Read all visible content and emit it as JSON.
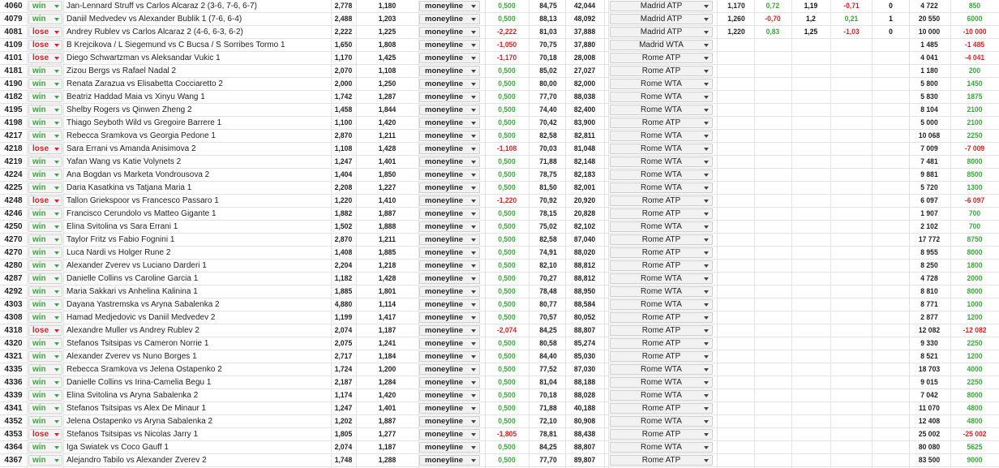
{
  "colors": {
    "win": "#38a838",
    "lose": "#e02020",
    "grid": "#e3e3e3"
  },
  "rows": [
    {
      "id": "4060",
      "result": "win",
      "match": "Jan-Lennard Struff vs Carlos Alcaraz 2 (3-6, 7-6, 6-7)",
      "odds": "2,778",
      "opp": "1,180",
      "market": "moneyline",
      "pl": "0,500",
      "pl_color": "g",
      "p1": "84,75",
      "p2": "42,044",
      "event": "Madrid ATP",
      "e1": "1,170",
      "e2": "0,72",
      "e3": "1,19",
      "e4": "-0,71",
      "e5": "0",
      "bank": "4 722",
      "profit": "850",
      "profit_color": "g"
    },
    {
      "id": "4079",
      "result": "win",
      "match": "Daniil Medvedev vs Alexander Bublik 1 (7-6, 6-4)",
      "odds": "2,488",
      "opp": "1,203",
      "market": "moneyline",
      "pl": "0,500",
      "pl_color": "g",
      "p1": "88,13",
      "p2": "48,092",
      "event": "Madrid ATP",
      "e1": "1,260",
      "e2": "-0,70",
      "e3": "1,2",
      "e4": "0,21",
      "e5": "1",
      "bank": "20 550",
      "profit": "6000",
      "profit_color": "g"
    },
    {
      "id": "4081",
      "result": "lose",
      "match": "Andrey Rublev vs Carlos Alcaraz 2 (4-6, 6-3, 6-2)",
      "odds": "2,222",
      "opp": "1,225",
      "market": "moneyline",
      "pl": "-2,222",
      "pl_color": "r",
      "p1": "81,03",
      "p2": "37,888",
      "event": "Madrid ATP",
      "e1": "1,220",
      "e2": "0,83",
      "e3": "1,25",
      "e4": "-1,03",
      "e5": "0",
      "bank": "10 000",
      "profit": "-10 000",
      "profit_color": "r"
    },
    {
      "id": "4109",
      "result": "lose",
      "match": "B Krejcikova / L Siegemund vs C Bucsa / S Sorribes Tormo 1",
      "odds": "1,650",
      "opp": "1,808",
      "market": "moneyline",
      "pl": "-1,050",
      "pl_color": "r",
      "p1": "70,75",
      "p2": "37,880",
      "event": "Madrid WTA",
      "e1": "",
      "e2": "",
      "e3": "",
      "e4": "",
      "e5": "",
      "bank": "1 485",
      "profit": "-1 485",
      "profit_color": "r"
    },
    {
      "id": "4101",
      "result": "lose",
      "match": "Diego Schwartzman vs Aleksandar Vukic 1",
      "odds": "1,170",
      "opp": "1,425",
      "market": "moneyline",
      "pl": "-1,170",
      "pl_color": "r",
      "p1": "70,18",
      "p2": "28,008",
      "event": "Rome ATP",
      "e1": "",
      "e2": "",
      "e3": "",
      "e4": "",
      "e5": "",
      "bank": "4 041",
      "profit": "-4 041",
      "profit_color": "r"
    },
    {
      "id": "4181",
      "result": "win",
      "match": "Zizou Bergs vs Rafael Nadal 2",
      "odds": "2,070",
      "opp": "1,108",
      "market": "moneyline",
      "pl": "0,500",
      "pl_color": "g",
      "p1": "85,02",
      "p2": "27,027",
      "event": "Rome ATP",
      "e1": "",
      "e2": "",
      "e3": "",
      "e4": "",
      "e5": "",
      "bank": "1 180",
      "profit": "200",
      "profit_color": "g"
    },
    {
      "id": "4190",
      "result": "win",
      "match": "Renata Zarazua vs Elisabetta Cocciaretto 2",
      "odds": "2,000",
      "opp": "1,250",
      "market": "moneyline",
      "pl": "0,500",
      "pl_color": "g",
      "p1": "80,00",
      "p2": "82,000",
      "event": "Rome WTA",
      "e1": "",
      "e2": "",
      "e3": "",
      "e4": "",
      "e5": "",
      "bank": "5 800",
      "profit": "1450",
      "profit_color": "g"
    },
    {
      "id": "4182",
      "result": "win",
      "match": "Beatriz Haddad Maia vs Xinyu Wang 1",
      "odds": "1,742",
      "opp": "1,287",
      "market": "moneyline",
      "pl": "0,500",
      "pl_color": "g",
      "p1": "77,70",
      "p2": "88,038",
      "event": "Rome WTA",
      "e1": "",
      "e2": "",
      "e3": "",
      "e4": "",
      "e5": "",
      "bank": "5 830",
      "profit": "1875",
      "profit_color": "g"
    },
    {
      "id": "4195",
      "result": "win",
      "match": "Shelby Rogers vs Qinwen Zheng 2",
      "odds": "1,458",
      "opp": "1,844",
      "market": "moneyline",
      "pl": "0,500",
      "pl_color": "g",
      "p1": "74,40",
      "p2": "82,400",
      "event": "Rome WTA",
      "e1": "",
      "e2": "",
      "e3": "",
      "e4": "",
      "e5": "",
      "bank": "8 104",
      "profit": "2100",
      "profit_color": "g"
    },
    {
      "id": "4198",
      "result": "win",
      "match": "Thiago Seyboth Wild vs Gregoire Barrere 1",
      "odds": "1,100",
      "opp": "1,420",
      "market": "moneyline",
      "pl": "0,500",
      "pl_color": "g",
      "p1": "70,42",
      "p2": "83,900",
      "event": "Rome ATP",
      "e1": "",
      "e2": "",
      "e3": "",
      "e4": "",
      "e5": "",
      "bank": "5 000",
      "profit": "2100",
      "profit_color": "g"
    },
    {
      "id": "4217",
      "result": "win",
      "match": "Rebecca Sramkova vs Georgia Pedone 1",
      "odds": "2,870",
      "opp": "1,211",
      "market": "moneyline",
      "pl": "0,500",
      "pl_color": "g",
      "p1": "82,58",
      "p2": "82,811",
      "event": "Rome WTA",
      "e1": "",
      "e2": "",
      "e3": "",
      "e4": "",
      "e5": "",
      "bank": "10 068",
      "profit": "2250",
      "profit_color": "g"
    },
    {
      "id": "4218",
      "result": "lose",
      "match": "Sara Errani vs Amanda Anisimova 2",
      "odds": "1,108",
      "opp": "1,428",
      "market": "moneyline",
      "pl": "-1,108",
      "pl_color": "r",
      "p1": "70,03",
      "p2": "81,048",
      "event": "Rome WTA",
      "e1": "",
      "e2": "",
      "e3": "",
      "e4": "",
      "e5": "",
      "bank": "7 009",
      "profit": "-7 009",
      "profit_color": "r"
    },
    {
      "id": "4219",
      "result": "win",
      "match": "Yafan Wang vs Katie Volynets 2",
      "odds": "1,247",
      "opp": "1,401",
      "market": "moneyline",
      "pl": "0,500",
      "pl_color": "g",
      "p1": "71,88",
      "p2": "82,148",
      "event": "Rome WTA",
      "e1": "",
      "e2": "",
      "e3": "",
      "e4": "",
      "e5": "",
      "bank": "7 481",
      "profit": "8000",
      "profit_color": "g"
    },
    {
      "id": "4224",
      "result": "win",
      "match": "Ana Bogdan vs Marketa Vondrousova 2",
      "odds": "1,404",
      "opp": "1,850",
      "market": "moneyline",
      "pl": "0,500",
      "pl_color": "g",
      "p1": "78,75",
      "p2": "82,183",
      "event": "Rome WTA",
      "e1": "",
      "e2": "",
      "e3": "",
      "e4": "",
      "e5": "",
      "bank": "9 881",
      "profit": "8500",
      "profit_color": "g"
    },
    {
      "id": "4225",
      "result": "win",
      "match": "Daria Kasatkina vs Tatjana Maria 1",
      "odds": "2,208",
      "opp": "1,227",
      "market": "moneyline",
      "pl": "0,500",
      "pl_color": "g",
      "p1": "81,50",
      "p2": "82,001",
      "event": "Rome WTA",
      "e1": "",
      "e2": "",
      "e3": "",
      "e4": "",
      "e5": "",
      "bank": "5 720",
      "profit": "1300",
      "profit_color": "g"
    },
    {
      "id": "4248",
      "result": "lose",
      "match": "Tallon Griekspoor vs Francesco Passaro 1",
      "odds": "1,220",
      "opp": "1,410",
      "market": "moneyline",
      "pl": "-1,220",
      "pl_color": "r",
      "p1": "70,92",
      "p2": "20,920",
      "event": "Rome ATP",
      "e1": "",
      "e2": "",
      "e3": "",
      "e4": "",
      "e5": "",
      "bank": "6 097",
      "profit": "-6 097",
      "profit_color": "r"
    },
    {
      "id": "4246",
      "result": "win",
      "match": "Francisco Cerundolo vs Matteo Gigante 1",
      "odds": "1,882",
      "opp": "1,887",
      "market": "moneyline",
      "pl": "0,500",
      "pl_color": "g",
      "p1": "78,15",
      "p2": "20,828",
      "event": "Rome ATP",
      "e1": "",
      "e2": "",
      "e3": "",
      "e4": "",
      "e5": "",
      "bank": "1 907",
      "profit": "700",
      "profit_color": "g"
    },
    {
      "id": "4250",
      "result": "win",
      "match": "Elina Svitolina vs Sara Errani 1",
      "odds": "1,502",
      "opp": "1,888",
      "market": "moneyline",
      "pl": "0,500",
      "pl_color": "g",
      "p1": "75,02",
      "p2": "82,102",
      "event": "Rome WTA",
      "e1": "",
      "e2": "",
      "e3": "",
      "e4": "",
      "e5": "",
      "bank": "2 102",
      "profit": "700",
      "profit_color": "g"
    },
    {
      "id": "4270",
      "result": "win",
      "match": "Taylor Fritz vs Fabio Fognini 1",
      "odds": "2,870",
      "opp": "1,211",
      "market": "moneyline",
      "pl": "0,500",
      "pl_color": "g",
      "p1": "82,58",
      "p2": "87,040",
      "event": "Rome ATP",
      "e1": "",
      "e2": "",
      "e3": "",
      "e4": "",
      "e5": "",
      "bank": "17 772",
      "profit": "8750",
      "profit_color": "g"
    },
    {
      "id": "4270",
      "result": "win",
      "match": "Luca Nardi vs Holger Rune 2",
      "odds": "1,408",
      "opp": "1,885",
      "market": "moneyline",
      "pl": "0,500",
      "pl_color": "g",
      "p1": "74,91",
      "p2": "88,020",
      "event": "Rome ATP",
      "e1": "",
      "e2": "",
      "e3": "",
      "e4": "",
      "e5": "",
      "bank": "8 955",
      "profit": "8000",
      "profit_color": "g"
    },
    {
      "id": "4280",
      "result": "win",
      "match": "Alexander Zverev vs Luciano Darderi 1",
      "odds": "2,204",
      "opp": "1,218",
      "market": "moneyline",
      "pl": "0,500",
      "pl_color": "g",
      "p1": "82,10",
      "p2": "88,812",
      "event": "Rome ATP",
      "e1": "",
      "e2": "",
      "e3": "",
      "e4": "",
      "e5": "",
      "bank": "8 250",
      "profit": "1800",
      "profit_color": "g"
    },
    {
      "id": "4287",
      "result": "win",
      "match": "Danielle Collins vs Caroline Garcia 1",
      "odds": "1,182",
      "opp": "1,428",
      "market": "moneyline",
      "pl": "0,500",
      "pl_color": "g",
      "p1": "70,27",
      "p2": "88,812",
      "event": "Rome WTA",
      "e1": "",
      "e2": "",
      "e3": "",
      "e4": "",
      "e5": "",
      "bank": "4 728",
      "profit": "2000",
      "profit_color": "g"
    },
    {
      "id": "4292",
      "result": "win",
      "match": "Maria Sakkari vs Anhelina Kalinina 1",
      "odds": "1,885",
      "opp": "1,801",
      "market": "moneyline",
      "pl": "0,500",
      "pl_color": "g",
      "p1": "78,48",
      "p2": "88,950",
      "event": "Rome WTA",
      "e1": "",
      "e2": "",
      "e3": "",
      "e4": "",
      "e5": "",
      "bank": "8 810",
      "profit": "8000",
      "profit_color": "g"
    },
    {
      "id": "4303",
      "result": "win",
      "match": "Dayana Yastremska vs Aryna Sabalenka 2",
      "odds": "4,880",
      "opp": "1,114",
      "market": "moneyline",
      "pl": "0,500",
      "pl_color": "g",
      "p1": "80,77",
      "p2": "88,584",
      "event": "Rome WTA",
      "e1": "",
      "e2": "",
      "e3": "",
      "e4": "",
      "e5": "",
      "bank": "8 771",
      "profit": "1000",
      "profit_color": "g"
    },
    {
      "id": "4308",
      "result": "win",
      "match": "Hamad Medjedovic vs Daniil Medvedev 2",
      "odds": "1,199",
      "opp": "1,417",
      "market": "moneyline",
      "pl": "0,500",
      "pl_color": "g",
      "p1": "70,57",
      "p2": "80,052",
      "event": "Rome ATP",
      "e1": "",
      "e2": "",
      "e3": "",
      "e4": "",
      "e5": "",
      "bank": "2 877",
      "profit": "1200",
      "profit_color": "g"
    },
    {
      "id": "4318",
      "result": "lose",
      "match": "Alexandre Muller vs Andrey Rublev 2",
      "odds": "2,074",
      "opp": "1,187",
      "market": "moneyline",
      "pl": "-2,074",
      "pl_color": "r",
      "p1": "84,25",
      "p2": "88,807",
      "event": "Rome ATP",
      "e1": "",
      "e2": "",
      "e3": "",
      "e4": "",
      "e5": "",
      "bank": "12 082",
      "profit": "-12 082",
      "profit_color": "r"
    },
    {
      "id": "4320",
      "result": "win",
      "match": "Stefanos Tsitsipas vs Cameron Norrie 1",
      "odds": "2,075",
      "opp": "1,241",
      "market": "moneyline",
      "pl": "0,500",
      "pl_color": "g",
      "p1": "80,58",
      "p2": "85,274",
      "event": "Rome ATP",
      "e1": "",
      "e2": "",
      "e3": "",
      "e4": "",
      "e5": "",
      "bank": "9 330",
      "profit": "2250",
      "profit_color": "g"
    },
    {
      "id": "4321",
      "result": "win",
      "match": "Alexander Zverev vs Nuno Borges 1",
      "odds": "2,717",
      "opp": "1,184",
      "market": "moneyline",
      "pl": "0,500",
      "pl_color": "g",
      "p1": "84,40",
      "p2": "85,030",
      "event": "Rome ATP",
      "e1": "",
      "e2": "",
      "e3": "",
      "e4": "",
      "e5": "",
      "bank": "8 521",
      "profit": "1200",
      "profit_color": "g"
    },
    {
      "id": "4335",
      "result": "win",
      "match": "Rebecca Sramkova vs Jelena Ostapenko 2",
      "odds": "1,724",
      "opp": "1,200",
      "market": "moneyline",
      "pl": "0,500",
      "pl_color": "g",
      "p1": "77,52",
      "p2": "87,030",
      "event": "Rome WTA",
      "e1": "",
      "e2": "",
      "e3": "",
      "e4": "",
      "e5": "",
      "bank": "18 703",
      "profit": "4000",
      "profit_color": "g"
    },
    {
      "id": "4336",
      "result": "win",
      "match": "Danielle Collins vs Irina-Camelia Begu 1",
      "odds": "2,187",
      "opp": "1,284",
      "market": "moneyline",
      "pl": "0,500",
      "pl_color": "g",
      "p1": "81,04",
      "p2": "88,188",
      "event": "Rome WTA",
      "e1": "",
      "e2": "",
      "e3": "",
      "e4": "",
      "e5": "",
      "bank": "9 015",
      "profert": "",
      "profit": "2250",
      "profit_color": "g"
    },
    {
      "id": "4339",
      "result": "win",
      "match": "Elina Svitolina vs Aryna Sabalenka 2",
      "odds": "1,174",
      "opp": "1,420",
      "market": "moneyline",
      "pl": "0,500",
      "pl_color": "g",
      "p1": "70,18",
      "p2": "88,028",
      "event": "Rome WTA",
      "e1": "",
      "e2": "",
      "e3": "",
      "e4": "",
      "e5": "",
      "bank": "7 042",
      "profit": "8000",
      "profit_color": "g"
    },
    {
      "id": "4341",
      "result": "win",
      "match": "Stefanos Tsitsipas vs Alex De Minaur 1",
      "odds": "1,247",
      "opp": "1,401",
      "market": "moneyline",
      "pl": "0,500",
      "pl_color": "g",
      "p1": "71,88",
      "p2": "40,188",
      "event": "Rome ATP",
      "e1": "",
      "e2": "",
      "e3": "",
      "e4": "",
      "e5": "",
      "bank": "11 070",
      "profit": "4800",
      "profit_color": "g"
    },
    {
      "id": "4352",
      "result": "win",
      "match": "Jelena Ostapenko vs Aryna Sabalenka 2",
      "odds": "1,202",
      "opp": "1,887",
      "market": "moneyline",
      "pl": "0,500",
      "pl_color": "g",
      "p1": "72,10",
      "p2": "80,908",
      "event": "Rome WTA",
      "e1": "",
      "e2": "",
      "e3": "",
      "e4": "",
      "e5": "",
      "bank": "12 408",
      "profit": "4800",
      "profit_color": "g"
    },
    {
      "id": "4353",
      "result": "lose",
      "match": "Stefanos Tsitsipas vs Nicolas Jarry 1",
      "odds": "1,805",
      "opp": "1,277",
      "market": "moneyline",
      "pl": "-1,805",
      "pl_color": "r",
      "p1": "78,81",
      "p2": "88,438",
      "event": "Rome ATP",
      "e1": "",
      "e2": "",
      "e3": "",
      "e4": "",
      "e5": "",
      "bank": "25 002",
      "profit": "-25 002",
      "profit_color": "r"
    },
    {
      "id": "4364",
      "result": "win",
      "match": "Iga Swiatek vs Coco Gauff 1",
      "odds": "2,074",
      "opp": "1,187",
      "market": "moneyline",
      "pl": "0,500",
      "pl_color": "g",
      "p1": "84,25",
      "p2": "88,807",
      "event": "Rome WTA",
      "e1": "",
      "e2": "",
      "e3": "",
      "e4": "",
      "e5": "",
      "bank": "80 080",
      "profit": "5625",
      "profit_color": "g"
    },
    {
      "id": "4367",
      "result": "win",
      "match": "Alejandro Tabilo vs Alexander Zverev 2",
      "odds": "1,748",
      "opp": "1,288",
      "market": "moneyline",
      "pl": "0,500",
      "pl_color": "g",
      "p1": "77,70",
      "p2": "89,807",
      "event": "Rome ATP",
      "e1": "",
      "e2": "",
      "e3": "",
      "e4": "",
      "e5": "",
      "bank": "83 500",
      "profit": "9000",
      "profit_color": "g"
    }
  ]
}
